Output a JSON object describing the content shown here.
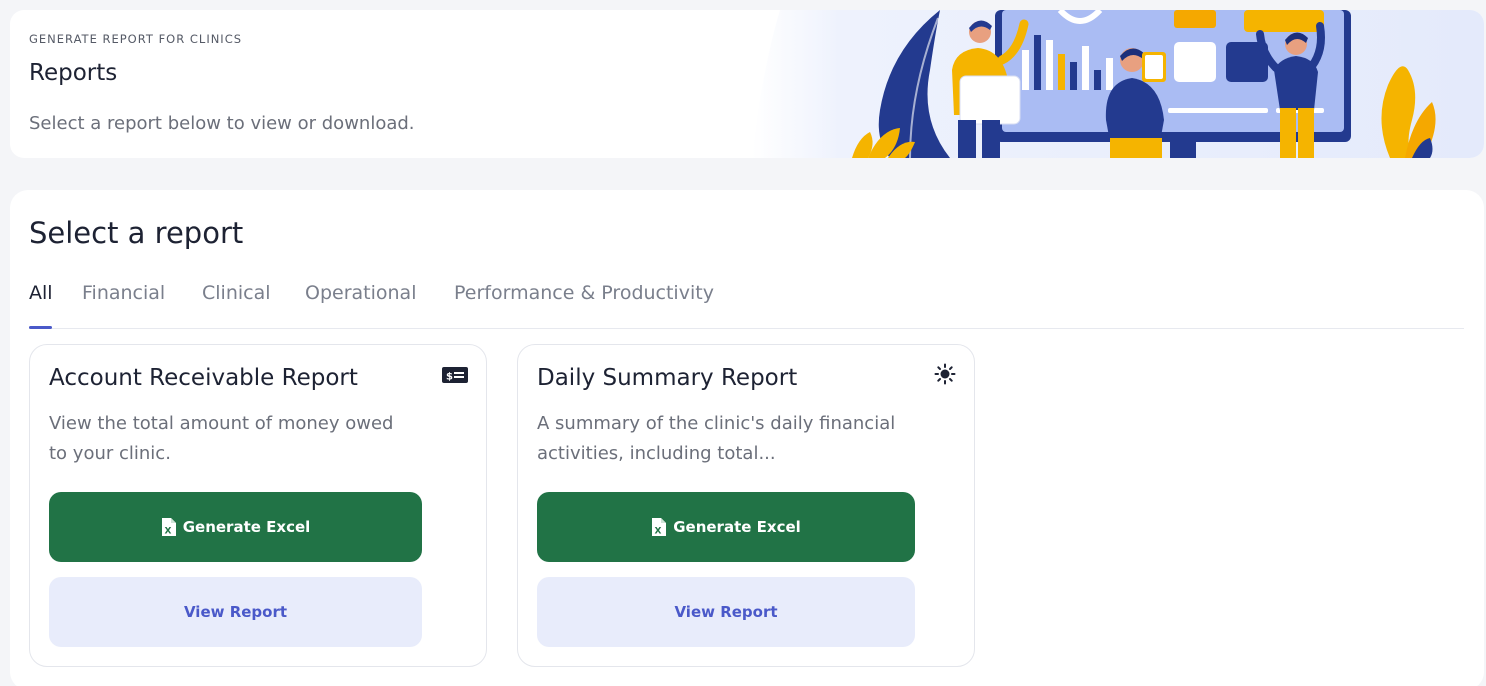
{
  "header": {
    "eyebrow": "GENERATE REPORT FOR CLINICS",
    "title": "Reports",
    "subtitle": "Select a report below to view or download."
  },
  "main": {
    "section_title": "Select a report",
    "tabs": [
      {
        "label": "All",
        "active": true
      },
      {
        "label": "Financial",
        "active": false
      },
      {
        "label": "Clinical",
        "active": false
      },
      {
        "label": "Operational",
        "active": false
      },
      {
        "label": "Performance & Productivity",
        "active": false
      }
    ],
    "reports": [
      {
        "title": "Account Receivable Report",
        "icon": "money-bill-icon",
        "description": "View the total amount of money owed to your clinic.",
        "excel_label": "Generate Excel",
        "view_label": "View Report"
      },
      {
        "title": "Daily Summary Report",
        "icon": "sun-icon",
        "description": "A summary of the clinic's daily financial activities, including total...",
        "excel_label": "Generate Excel",
        "view_label": "View Report"
      }
    ]
  },
  "colors": {
    "accent": "#4a59c9",
    "excel_green": "#217346",
    "view_button_bg": "#e8ecfb",
    "page_bg": "#f4f5f8"
  }
}
